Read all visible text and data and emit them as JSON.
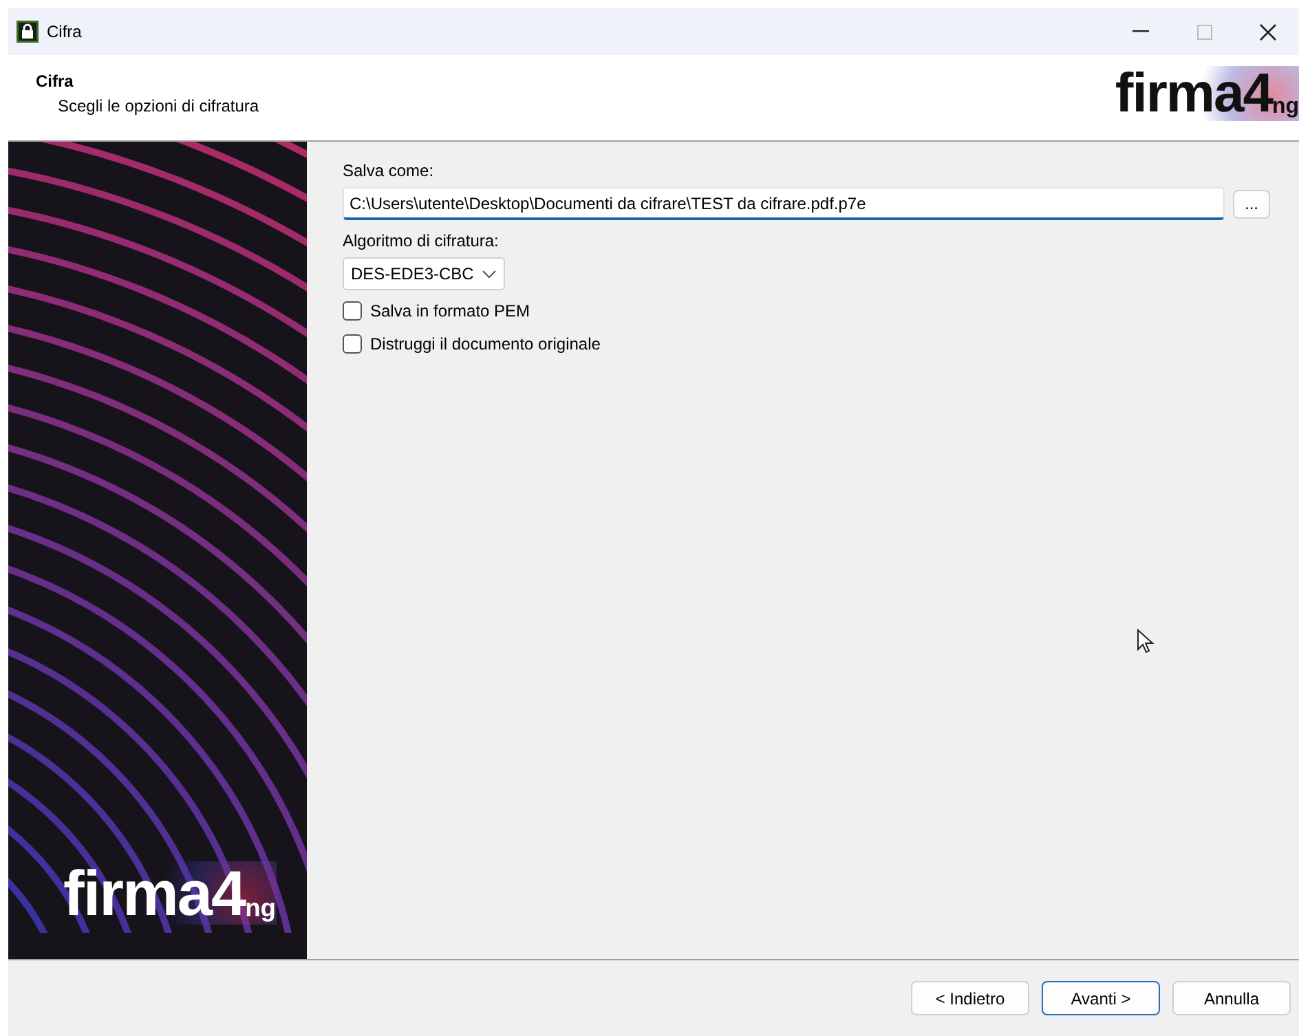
{
  "window": {
    "title": "Cifra"
  },
  "header": {
    "title": "Cifra",
    "subtitle": "Scegli le opzioni di cifratura",
    "logo": {
      "main": "firma4",
      "suffix": "ng"
    }
  },
  "banner": {
    "logo": {
      "main": "firma4",
      "suffix": "ng"
    }
  },
  "form": {
    "save_as_label": "Salva come:",
    "save_as_value": "C:\\Users\\utente\\Desktop\\Documenti da cifrare\\TEST da cifrare.pdf.p7e",
    "browse_button": "...",
    "algorithm_label": "Algoritmo di cifratura:",
    "algorithm_value": "DES-EDE3-CBC",
    "options": [
      {
        "label": "Salva in formato PEM",
        "checked": false
      },
      {
        "label": "Distruggi il documento originale",
        "checked": false
      }
    ]
  },
  "buttons": [
    {
      "label": "< Indietro",
      "selected": false
    },
    {
      "label": "Avanti >",
      "selected": true
    },
    {
      "label": "Annulla",
      "selected": false
    }
  ]
}
